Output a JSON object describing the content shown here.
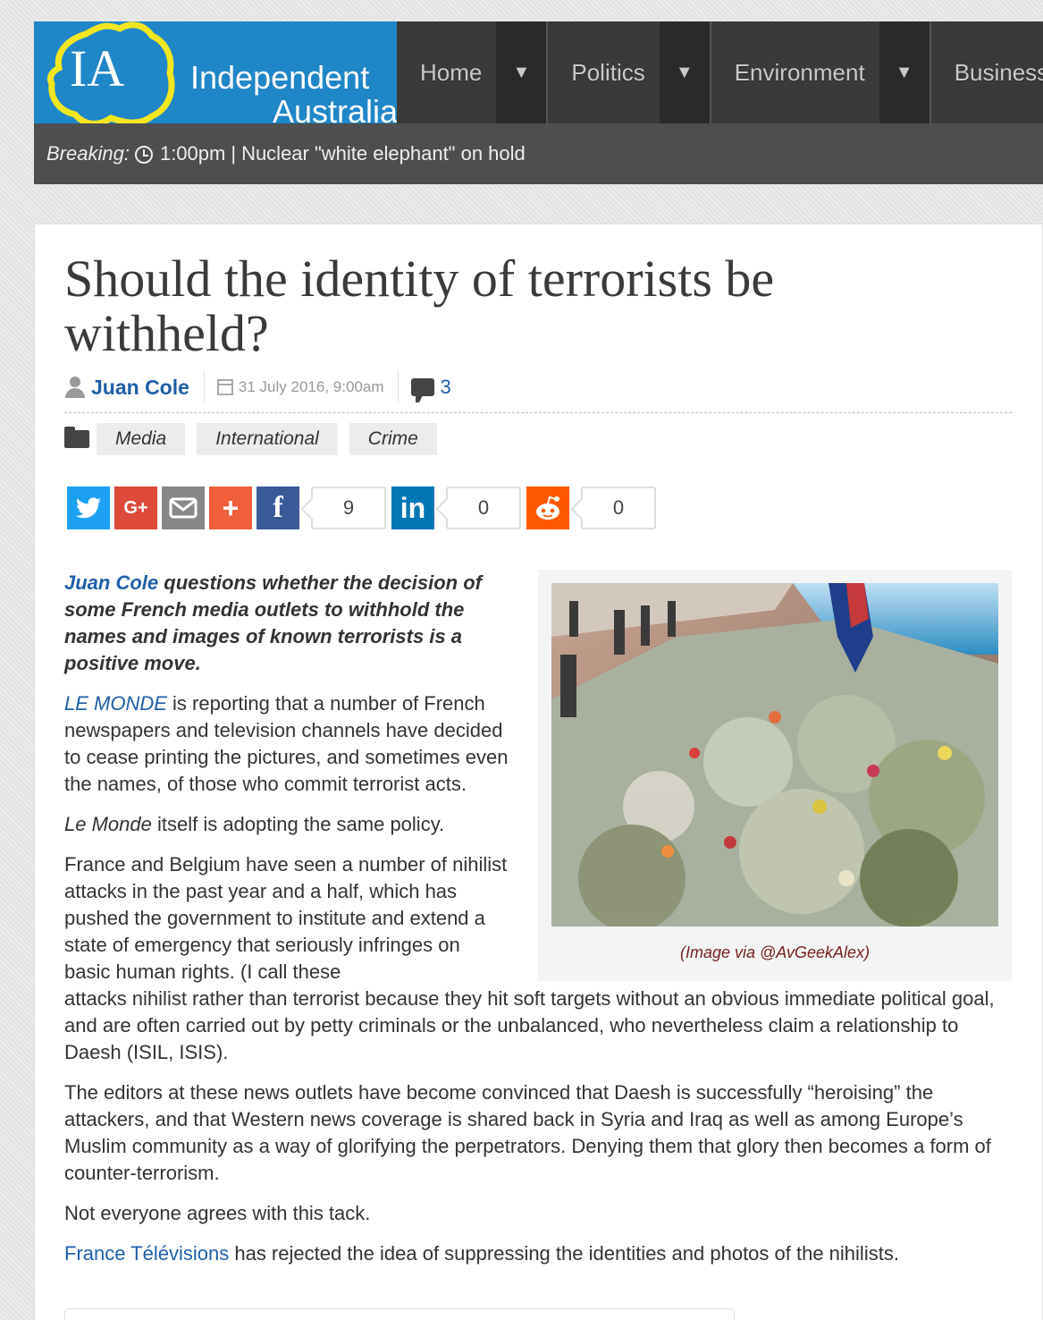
{
  "site": {
    "logo_mark": "IA",
    "name_line1": "Independent",
    "name_line2": "Australia"
  },
  "nav": {
    "items": [
      {
        "label": "Home",
        "caret": "▼"
      },
      {
        "label": "Politics",
        "caret": "▼"
      },
      {
        "label": "Environment",
        "caret": "▼"
      },
      {
        "label": "Business",
        "caret": ""
      }
    ]
  },
  "breaking": {
    "label": "Breaking:",
    "time": "1:00pm",
    "separator": "|",
    "headline": "Nuclear \"white elephant\" on hold"
  },
  "article": {
    "title": "Should the identity of terrorists be withheld?",
    "author": "Juan Cole",
    "date": "31 July 2016, 9:00am",
    "comment_count": "3",
    "tags": [
      "Media",
      "International",
      "Crime"
    ],
    "share": {
      "googleplus_label": "G+",
      "plus_label": "+",
      "facebook_label": "f",
      "linkedin_label": "in",
      "facebook_count": "9",
      "linkedin_count": "0",
      "reddit_count": "0"
    },
    "image_caption": "(Image via @AvGeekAlex)",
    "lead_author": "Juan Cole",
    "lead_rest": " questions whether the decision of some French media outlets to withhold the names and images of known terrorists is a positive move.",
    "p1_link": "LE MONDE",
    "p1_rest": " is reporting that a number of French newspapers and television channels have decided to cease printing the pictures, and sometimes even the names, of those who commit terrorist acts.",
    "p2_italic": "Le Monde",
    "p2_rest": " itself is adopting the same policy.",
    "p3_first": "France and Belgium have seen a number of nihilist attacks in the past year and a half, which has pushed the government to institute and extend a state of emergency that seriously infringes on basic human rights. (I call these",
    "p3_rest": "attacks nihilist rather than terrorist because they hit soft targets without an obvious immediate political goal, and are often carried out by petty criminals or the unbalanced, who nevertheless claim a relationship to Daesh (ISIL, ISIS).",
    "p4": "The editors at these news outlets have become convinced that Daesh is successfully “heroising” the attackers, and that Western news coverage is shared back in Syria and Iraq as well as among Europe’s Muslim community as a way of glorifying the perpetrators. Denying them that glory then becomes a form of counter-terrorism.",
    "p5": "Not everyone agrees with this tack.",
    "p6_link": "France Télévisions",
    "p6_rest": " has rejected the idea of suppressing the identities and photos of the nihilists."
  }
}
